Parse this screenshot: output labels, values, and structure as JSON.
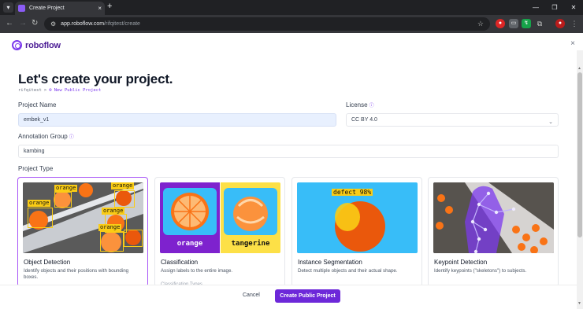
{
  "browser": {
    "tab_title": "Create Project",
    "url_host": "app.roboflow.com",
    "url_path": "/rifqitest/create",
    "new_tab": "+",
    "close_glyph": "×"
  },
  "app": {
    "logo_text": "roboflow",
    "close_label": "×"
  },
  "header": {
    "title": "Let's create your project.",
    "breadcrumb_workspace": "rifqitest",
    "breadcrumb_sep": ">",
    "breadcrumb_current": "New Public Project"
  },
  "form": {
    "project_name_label": "Project Name",
    "project_name_value": "embek_v1",
    "license_label": "License",
    "license_value": "CC BY 4.0",
    "annotation_group_label": "Annotation Group",
    "annotation_group_value": "kambing",
    "project_type_label": "Project Type"
  },
  "project_types": [
    {
      "title": "Object Detection",
      "description": "Identify objects and their positions with bounding boxes.",
      "selected": true
    },
    {
      "title": "Classification",
      "description": "Assign labels to the entire image.",
      "extra": "Classification Types"
    },
    {
      "title": "Instance Segmentation",
      "description": "Detect multiple objects and their actual shape."
    },
    {
      "title": "Keypoint Detection",
      "description": "Identify keypoints (\"skeletons\") to subjects."
    }
  ],
  "thumbnails": {
    "detection_labels": [
      "orange",
      "orange",
      "orange",
      "orange",
      "orange",
      "orange"
    ],
    "classification_left": "orange",
    "classification_right": "tangerine",
    "segmentation_label": "defect 98%"
  },
  "footer": {
    "cancel_label": "Cancel",
    "create_label": "Create Public Project"
  },
  "colors": {
    "accent": "#6d28d9",
    "selected_border": "#a855f7",
    "label_yellow": "#facc15"
  }
}
